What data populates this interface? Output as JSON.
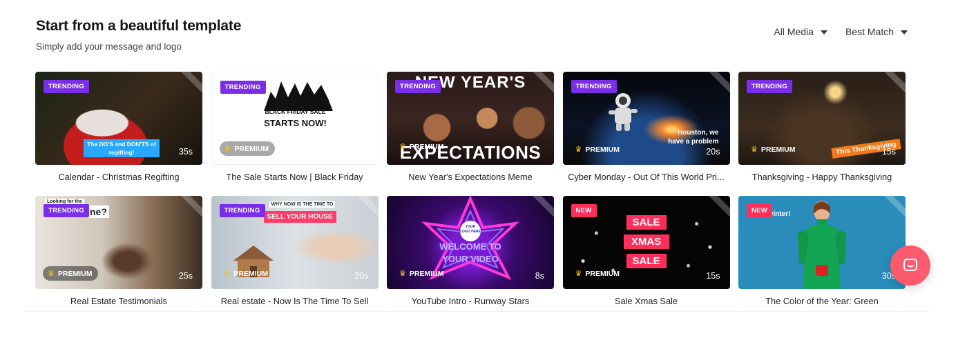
{
  "header": {
    "title": "Start from a beautiful template",
    "subtitle": "Simply add your message and logo"
  },
  "filters": {
    "media": "All Media",
    "sort": "Best Match"
  },
  "cards": [
    {
      "title": "Calendar - Christmas Regifting",
      "badge": "TRENDING",
      "duration": "35s",
      "overlay": "The DO'S and DON'TS of regifting!"
    },
    {
      "title": "The Sale Starts Now | Black Friday",
      "badge": "TRENDING",
      "premium": "PREMIUM",
      "overlay_line1": "BLACK FRIDAY SALE",
      "overlay_line2": "STARTS NOW!"
    },
    {
      "title": "New Year's Expectations Meme",
      "badge": "TRENDING",
      "premium": "PREMIUM",
      "overlay_top": "NEW YEAR'S",
      "overlay_bottom": "EXPECTATIONS"
    },
    {
      "title": "Cyber Monday - Out Of This World Pri...",
      "badge": "TRENDING",
      "premium": "PREMIUM",
      "duration": "20s",
      "overlay": "Houston, we have a problem"
    },
    {
      "title": "Thanksgiving - Happy Thanksgiving",
      "badge": "TRENDING",
      "premium": "PREMIUM",
      "duration": "15s",
      "overlay": "This Thanksgiving"
    },
    {
      "title": "Real Estate Testimonials",
      "badge": "TRENDING",
      "premium": "PREMIUM",
      "duration": "25s",
      "overlay_small": "Looking for the",
      "overlay": "ne?"
    },
    {
      "title": "Real estate - Now Is The Time To Sell",
      "badge": "TRENDING",
      "premium": "PREMIUM",
      "duration": "20s",
      "overlay_small": "WHY NOW IS THE TIME TO",
      "overlay": "SELL YOUR HOUSE"
    },
    {
      "title": "YouTube Intro - Runway Stars",
      "premium": "PREMIUM",
      "duration": "8s",
      "overlay_logo": "YOUR LOGO HERE",
      "overlay_line1": "WELCOME TO",
      "overlay_line2": "YOUR VIDEO"
    },
    {
      "title": "Sale Xmas Sale",
      "badge": "NEW",
      "premium": "PREMIUM",
      "duration": "15s",
      "overlay_line1": "SALE",
      "overlay_line2": "XMAS",
      "overlay_line3": "SALE"
    },
    {
      "title": "The Color of the Year: Green",
      "badge": "NEW",
      "duration": "30s",
      "overlay": "dy for winter!"
    }
  ],
  "colors": {
    "trending": "#7a2ee8",
    "new": "#ff2e5a",
    "chat": "#ff5a6e"
  },
  "icons": {
    "crown": "crown-icon",
    "caret": "caret-down-icon",
    "chat": "chat-icon"
  }
}
